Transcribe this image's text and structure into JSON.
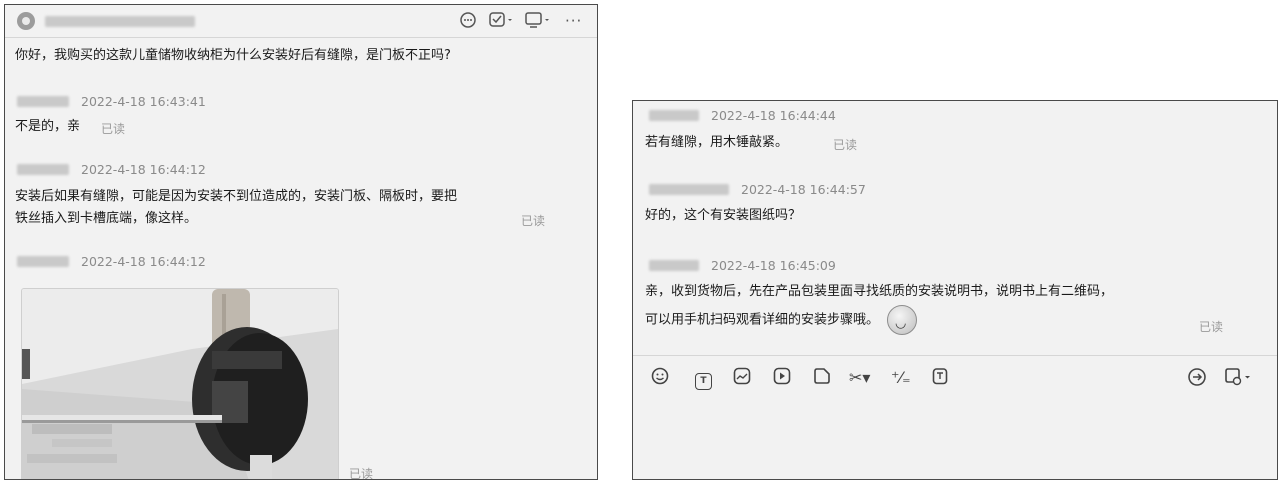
{
  "left_chat": {
    "first_message": "你好，我购买的这款儿童储物收纳柜为什么安装好后有缝隙，是门板不正吗?",
    "messages": [
      {
        "time": "2022-4-18 16:43:41",
        "text": "不是的，亲",
        "read": "已读"
      },
      {
        "time": "2022-4-18 16:44:12",
        "line1": "安装后如果有缝隙，可能是因为安装不到位造成的，安装门板、隔板时，要把",
        "line2": "铁丝插入到卡槽底端，像这样。",
        "read": "已读"
      },
      {
        "time": "2022-4-18 16:44:12",
        "read": "已读"
      }
    ]
  },
  "right_chat": {
    "messages": [
      {
        "time": "2022-4-18 16:44:44",
        "text": "若有缝隙，用木锤敲紧。",
        "read": "已读"
      },
      {
        "time": "2022-4-18 16:44:57",
        "text": "好的，这个有安装图纸吗？"
      },
      {
        "time": "2022-4-18 16:45:09",
        "line1": "亲，收到货物后，先在产品包装里面寻找纸质的安装说明书，说明书上有二维码，",
        "line2": "可以用手机扫码观看详细的安装步骤哦。",
        "read": "已读"
      }
    ]
  },
  "icons": {
    "header": [
      "chat-bubble-icon",
      "checklist-icon",
      "screen-share-icon",
      "more-icon"
    ],
    "toolbar_left": [
      "emoji-icon",
      "text-icon",
      "image-icon",
      "video-icon",
      "file-icon",
      "scissors-icon",
      "format-icon",
      "clipboard-icon"
    ],
    "toolbar_right": [
      "send-icon",
      "options-icon"
    ]
  },
  "colors": {
    "panel_bg": "#f2f2f2",
    "border": "#4a4a4a",
    "time_text": "#8a8a8a",
    "read_text": "#9a9a9a"
  }
}
